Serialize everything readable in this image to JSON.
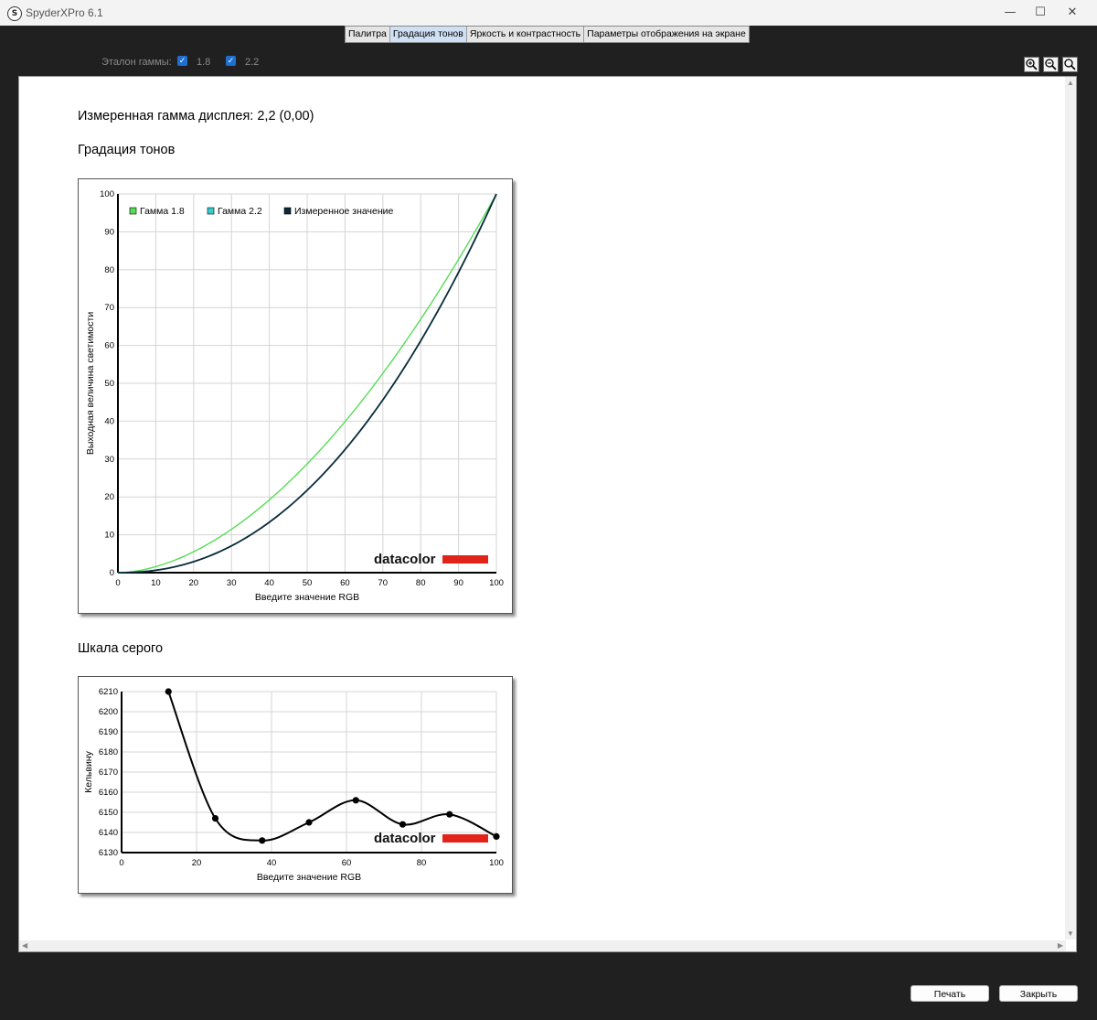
{
  "window": {
    "title": "SpyderXPro 6.1",
    "icon_letter": "S",
    "minimize": "—",
    "maximize": "☐",
    "close": "✕"
  },
  "tabs": [
    {
      "label": "Палитра"
    },
    {
      "label": "Градация тонов",
      "active": true
    },
    {
      "label": "Яркость и контрастность"
    },
    {
      "label": "Параметры отображения на экране"
    }
  ],
  "toolbar": {
    "gamma_ref_label": "Эталон гаммы:",
    "option_a": {
      "label": "1.8",
      "checked": true
    },
    "option_b": {
      "label": "2.2",
      "checked": true
    },
    "check_glyph": "✓"
  },
  "report": {
    "measured_gamma": "Измеренная гамма дисплея: 2,2 (0,00)",
    "tone_heading": "Градация тонов",
    "gray_heading": "Шкала серого"
  },
  "buttons": {
    "print": "Печать",
    "close": "Закрыть"
  },
  "logo_text": "datacolor",
  "colors": {
    "gamma18": "#55dd55",
    "gamma22": "#30d0d0",
    "measured": "#0a2a3a",
    "logo_red": "#e2231a"
  },
  "chart_data": [
    {
      "type": "line",
      "xlabel": "Введите значение RGB",
      "ylabel": "Выходная величина светимости",
      "xlim": [
        0,
        100
      ],
      "ylim": [
        0,
        100
      ],
      "xticks": [
        0,
        10,
        20,
        30,
        40,
        50,
        60,
        70,
        80,
        90,
        100
      ],
      "yticks": [
        0,
        10,
        20,
        30,
        40,
        50,
        60,
        70,
        80,
        90,
        100
      ],
      "grid": true,
      "legend_position": "top-left",
      "series": [
        {
          "name": "Гамма 1.8",
          "gamma": 1.8,
          "color": "#55dd55"
        },
        {
          "name": "Гамма 2.2",
          "gamma": 2.2,
          "color": "#30d0d0"
        },
        {
          "name": "Измеренное значение",
          "gamma": 2.2,
          "color": "#0a2a3a"
        }
      ]
    },
    {
      "type": "line",
      "xlabel": "Введите значение RGB",
      "ylabel": "Кельвину",
      "xlim": [
        0,
        100
      ],
      "ylim": [
        6130,
        6210
      ],
      "xticks": [
        0,
        20,
        40,
        60,
        80,
        100
      ],
      "yticks": [
        6130,
        6140,
        6150,
        6160,
        6170,
        6180,
        6190,
        6200,
        6210
      ],
      "grid": true,
      "series": [
        {
          "x": [
            12.5,
            25,
            37.5,
            50,
            62.5,
            75,
            87.5,
            100
          ],
          "y": [
            6210,
            6147,
            6136,
            6145,
            6156,
            6144,
            6149,
            6138
          ]
        }
      ]
    }
  ]
}
